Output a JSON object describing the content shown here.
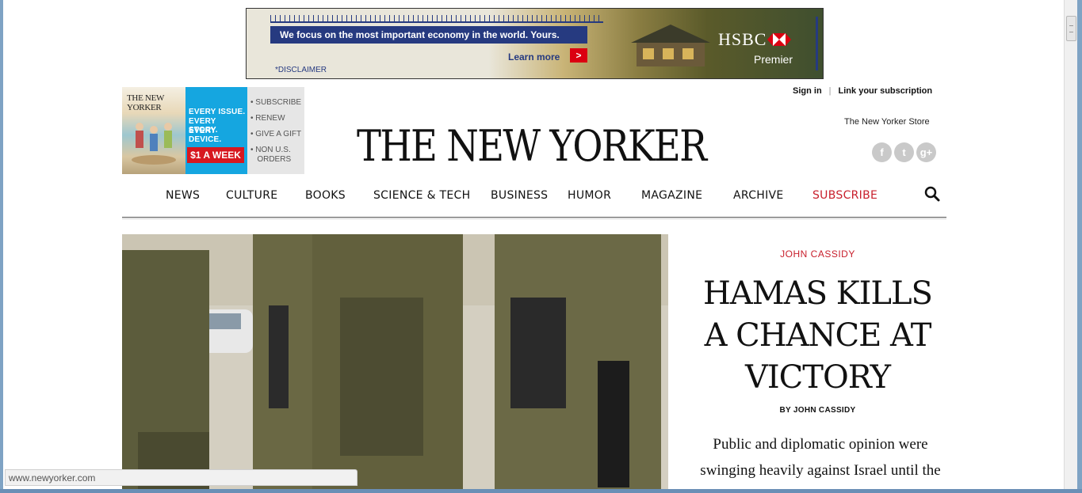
{
  "ad": {
    "slogan": "We focus on the most important economy in the world. Yours.",
    "learn_more": "Learn more",
    "arrow": ">",
    "disclaimer": "*DISCLAIMER",
    "brand": "HSBC",
    "tier": "Premier",
    "colors": {
      "brand_blue": "#263a80",
      "brand_red": "#db0011"
    }
  },
  "promo": {
    "cover_title": "THE NEW YORKER",
    "lines": [
      "EVERY ISSUE.",
      "EVERY STORY.",
      "EVERY DEVICE."
    ],
    "price": "$1 A WEEK",
    "links": [
      "• SUBSCRIBE",
      "• RENEW",
      "• GIVE A GIFT",
      "• NON U.S.\n   ORDERS"
    ]
  },
  "header": {
    "masthead": "THE NEW YORKER",
    "sign_in": "Sign in",
    "separator": "|",
    "link_subscription": "Link your subscription",
    "store": "The New Yorker Store",
    "social": [
      {
        "icon": "facebook-icon",
        "glyph": "f"
      },
      {
        "icon": "twitter-icon",
        "glyph": "t"
      },
      {
        "icon": "google-plus-icon",
        "glyph": "g+"
      }
    ]
  },
  "nav": {
    "items": [
      "NEWS",
      "CULTURE",
      "BOOKS",
      "SCIENCE & TECH",
      "BUSINESS",
      "HUMOR",
      "MAGAZINE",
      "ARCHIVE",
      "SUBSCRIBE"
    ],
    "search_icon": "search-icon",
    "accent": "#c81e2b"
  },
  "article": {
    "author_kicker": "JOHN CASSIDY",
    "headline": "HAMAS KILLS A CHANCE AT VICTORY",
    "byline": "BY JOHN CASSIDY",
    "dek": "Public and diplomatic opinion were swinging heavily against Israel until the"
  },
  "status_bar": {
    "url": "www.newyorker.com"
  }
}
